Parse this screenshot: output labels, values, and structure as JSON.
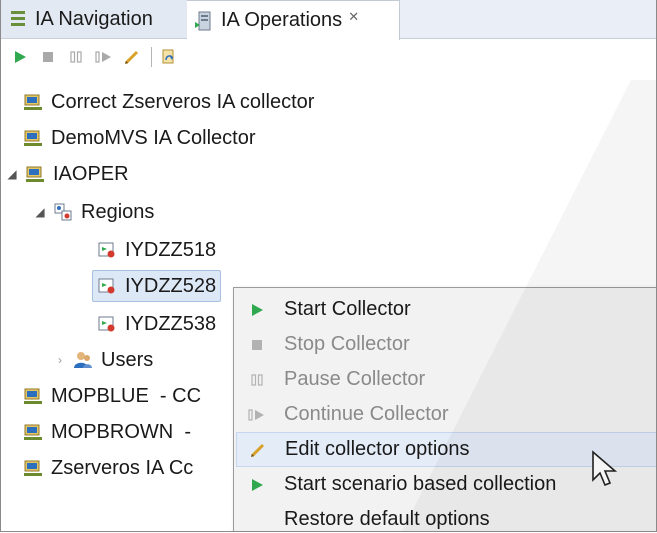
{
  "tabs": [
    {
      "label": "IA Navigation",
      "icon": "list-icon"
    },
    {
      "label": "IA Operations",
      "icon": "operations-icon",
      "close": "✕"
    }
  ],
  "toolbar": {
    "items": [
      "start-icon",
      "stop-icon",
      "pause-icon",
      "continue-icon",
      "edit-icon",
      "refresh-icon"
    ]
  },
  "tree": {
    "items": [
      {
        "label": "Correct Zserveros IA collector",
        "icon": "server-icon"
      },
      {
        "label": "DemoMVS IA Collector",
        "icon": "server-icon"
      },
      {
        "label": "IAOPER",
        "icon": "server-icon",
        "expanded": true
      },
      {
        "label": "Regions",
        "icon": "regions-icon",
        "expanded": true
      },
      {
        "label": "IYDZZ518",
        "icon": "region-icon"
      },
      {
        "label": "IYDZZ528",
        "icon": "region-icon",
        "selected": true
      },
      {
        "label": "IYDZZ538",
        "icon": "region-icon"
      },
      {
        "label": "Users",
        "icon": "users-icon",
        "expanded": false
      },
      {
        "label": "MOPBLUE  - CC",
        "icon": "server-icon"
      },
      {
        "label": "MOPBROWN  -",
        "icon": "server-icon"
      },
      {
        "label": "Zserveros IA Cc",
        "icon": "server-icon"
      }
    ]
  },
  "context_menu": {
    "items": [
      {
        "label": "Start Collector",
        "icon": "start-icon",
        "enabled": true
      },
      {
        "label": "Stop Collector",
        "icon": "stop-icon",
        "enabled": false
      },
      {
        "label": "Pause Collector",
        "icon": "pause-icon",
        "enabled": false
      },
      {
        "label": "Continue Collector",
        "icon": "continue-icon",
        "enabled": false
      },
      {
        "label": "Edit collector options",
        "icon": "edit-icon",
        "enabled": true,
        "hover": true
      },
      {
        "label": "Start scenario based collection",
        "icon": "start-icon",
        "enabled": true
      },
      {
        "label": "Restore default options",
        "icon": "",
        "enabled": true
      }
    ]
  },
  "colors": {
    "play_green": "#2fa84f",
    "disabled_gray": "#a9a9a9",
    "tab_bg": "#e9eef7",
    "selection": "#dde8f6",
    "menu_bg": "#f2f2f2"
  }
}
